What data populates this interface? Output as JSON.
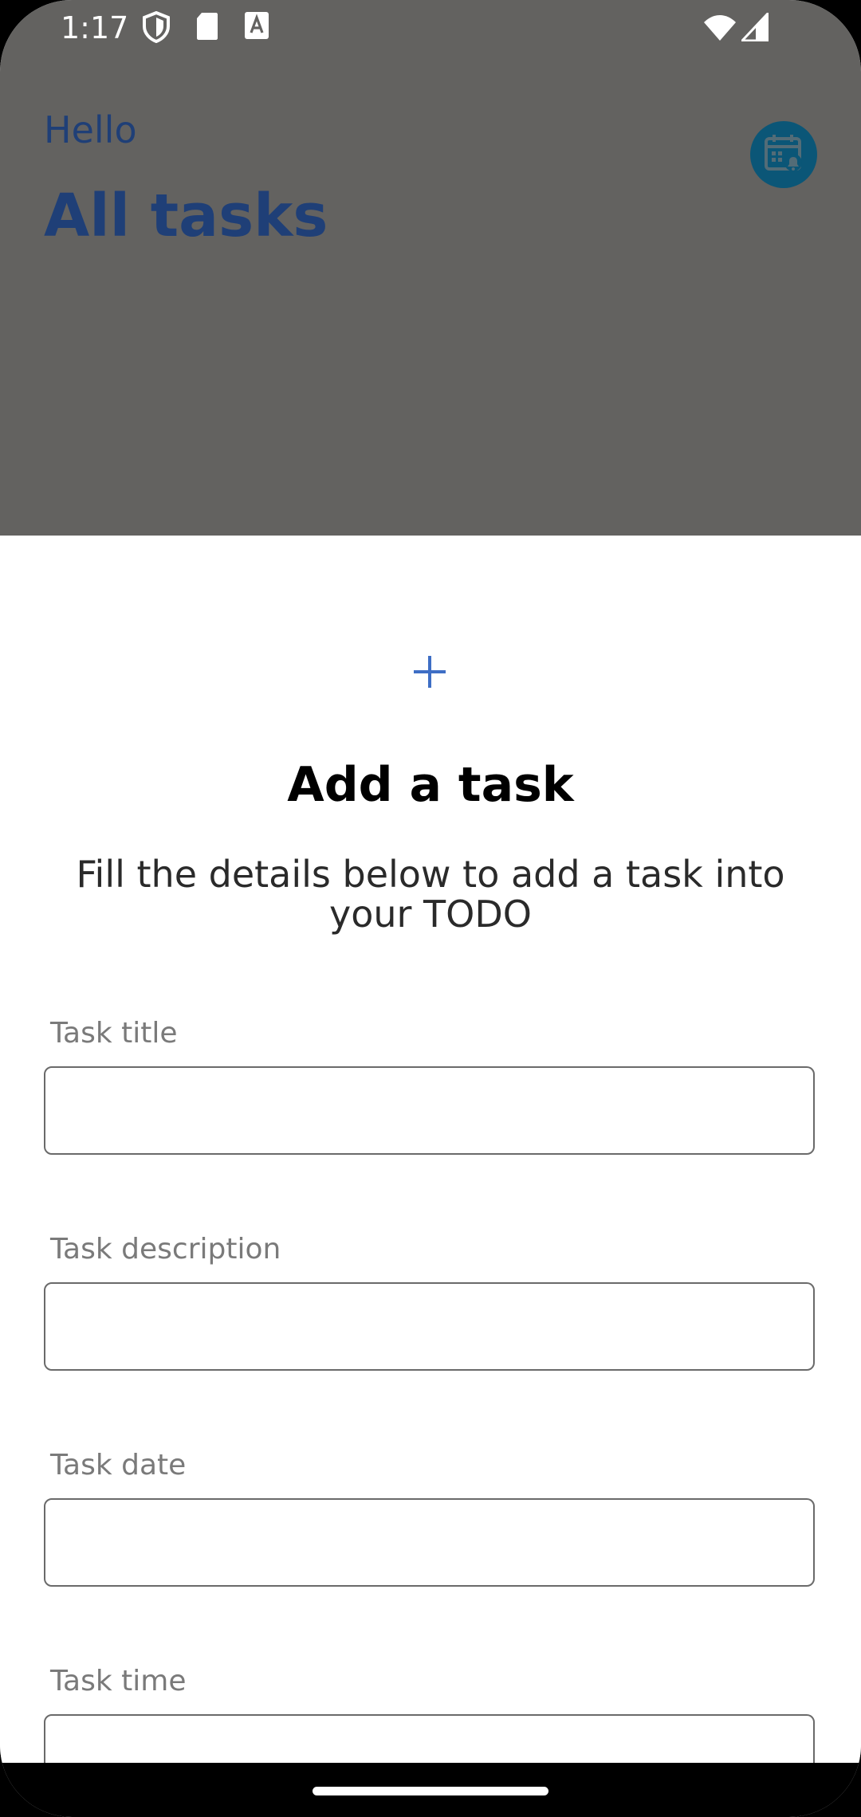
{
  "status_bar": {
    "time": "1:17",
    "icons": [
      "shield-icon",
      "sd-card-icon",
      "font-icon",
      "wifi-icon",
      "signal-icon"
    ]
  },
  "background_app": {
    "greeting": "Hello",
    "title": "All tasks",
    "calendar_icon": "calendar-bell-icon",
    "accent_color": "#1f3f77"
  },
  "sheet": {
    "icon": "plus-icon",
    "title": "Add a task",
    "subtitle": "Fill the details below to add a task into your TODO",
    "fields": [
      {
        "label": "Task title",
        "value": "",
        "placeholder": ""
      },
      {
        "label": "Task description",
        "value": "",
        "placeholder": ""
      },
      {
        "label": "Task date",
        "value": "",
        "placeholder": ""
      },
      {
        "label": "Task time",
        "value": "",
        "placeholder": ""
      }
    ]
  }
}
